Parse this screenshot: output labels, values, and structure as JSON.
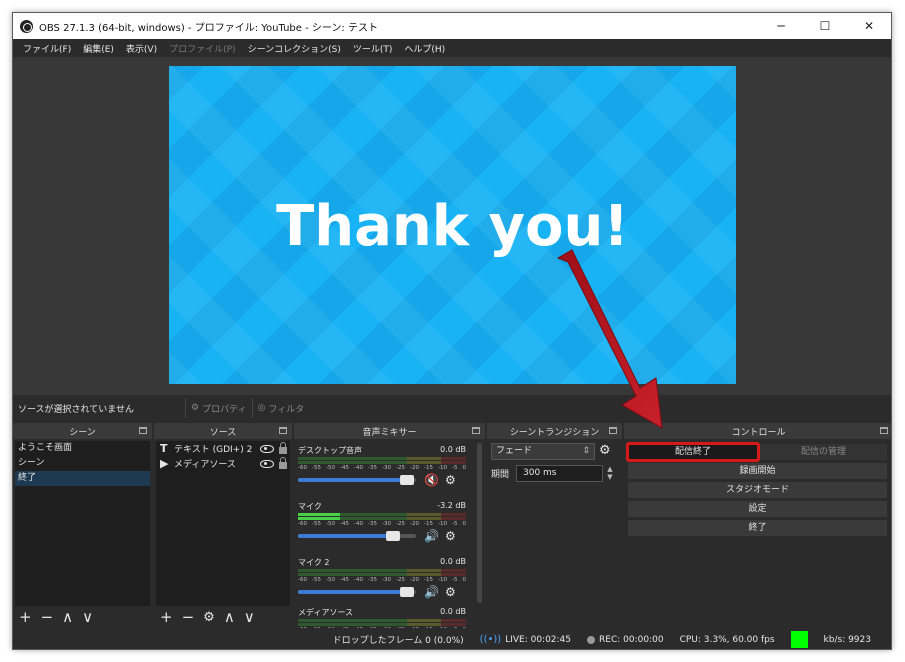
{
  "window": {
    "title": "OBS 27.1.3 (64-bit, windows) - プロファイル: YouTube - シーン: テスト"
  },
  "menu": [
    "ファイル(F)",
    "編集(E)",
    "表示(V)",
    "プロファイル(P)",
    "シーンコレクション(S)",
    "ツール(T)",
    "ヘルプ(H)"
  ],
  "preview": {
    "text": "Thank you!"
  },
  "context": {
    "no_source": "ソースが選択されていません",
    "properties": "プロパティ",
    "filters": "フィルタ"
  },
  "scenes": {
    "title": "シーン",
    "items": [
      "ようこそ画面",
      "シーン",
      "終了"
    ],
    "selected": 2
  },
  "sources": {
    "title": "ソース",
    "items": [
      {
        "icon": "T",
        "name": "テキスト (GDI+) 2"
      },
      {
        "icon": "▶",
        "name": "メディアソース"
      }
    ]
  },
  "mixer": {
    "title": "音声ミキサー",
    "scale": [
      "-60",
      "-55",
      "-50",
      "-45",
      "-40",
      "-35",
      "-30",
      "-25",
      "-20",
      "-15",
      "-10",
      "-5",
      "0"
    ],
    "channels": [
      {
        "name": "デスクトップ音声",
        "db": "0.0 dB",
        "level": 0.0,
        "fader": 0.95,
        "muted": true
      },
      {
        "name": "マイク",
        "db": "-3.2 dB",
        "level": 0.25,
        "fader": 0.83,
        "muted": false
      },
      {
        "name": "マイク 2",
        "db": "0.0 dB",
        "level": 0.0,
        "fader": 0.95,
        "muted": false
      },
      {
        "name": "メディアソース",
        "db": "0.0 dB",
        "level": 0.0,
        "fader": 0.95,
        "muted": false
      }
    ]
  },
  "transitions": {
    "title": "シーントランジション",
    "selected": "フェード",
    "duration_label": "期間",
    "duration": "300 ms"
  },
  "controls": {
    "title": "コントロール",
    "stop_stream": "配信終了",
    "manage_stream": "配信の管理",
    "start_recording": "録画開始",
    "studio_mode": "スタジオモード",
    "settings": "設定",
    "exit": "終了"
  },
  "status": {
    "dropped": "ドロップしたフレーム 0 (0.0%)",
    "live": "LIVE: 00:02:45",
    "rec": "REC: 00:00:00",
    "cpu": "CPU: 3.3%, 60.00 fps",
    "kbps": "kb/s: 9923"
  },
  "colors": {
    "accent": "#d61a1a",
    "health": "#00ff00",
    "preview_bg": "#17b3f4"
  }
}
